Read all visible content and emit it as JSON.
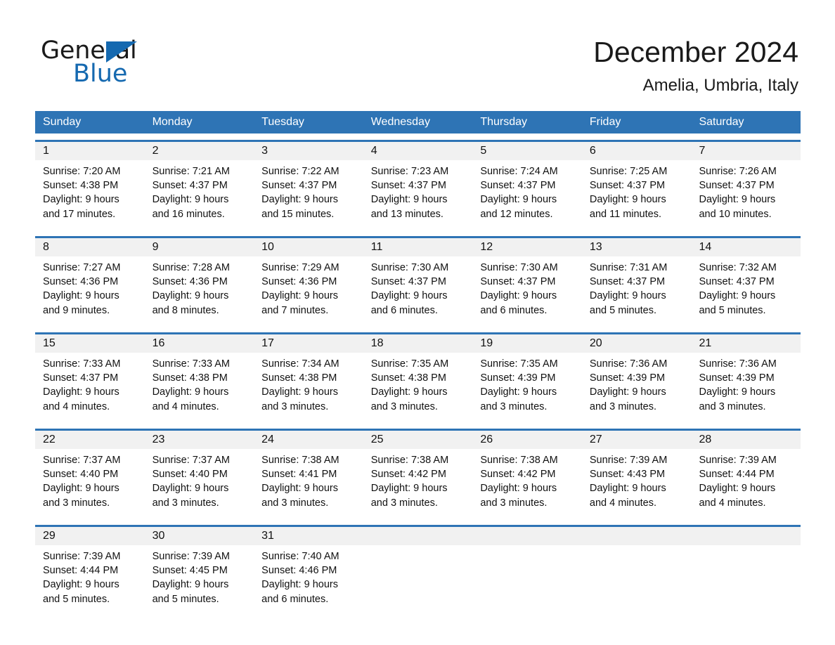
{
  "brand": {
    "name_part1": "General",
    "name_part2": "Blue",
    "triangle_color": "#1569b0"
  },
  "header": {
    "title": "December 2024",
    "subtitle": "Amelia, Umbria, Italy"
  },
  "theme": {
    "header_blue": "#2e74b5",
    "row_rule_blue": "#2e74b5",
    "daynum_band": "#f1f1f1",
    "text": "#111111"
  },
  "day_headers": [
    "Sunday",
    "Monday",
    "Tuesday",
    "Wednesday",
    "Thursday",
    "Friday",
    "Saturday"
  ],
  "weeks": [
    {
      "days": [
        {
          "num": "1",
          "l1": "Sunrise: 7:20 AM",
          "l2": "Sunset: 4:38 PM",
          "l3": "Daylight: 9 hours",
          "l4": "and 17 minutes."
        },
        {
          "num": "2",
          "l1": "Sunrise: 7:21 AM",
          "l2": "Sunset: 4:37 PM",
          "l3": "Daylight: 9 hours",
          "l4": "and 16 minutes."
        },
        {
          "num": "3",
          "l1": "Sunrise: 7:22 AM",
          "l2": "Sunset: 4:37 PM",
          "l3": "Daylight: 9 hours",
          "l4": "and 15 minutes."
        },
        {
          "num": "4",
          "l1": "Sunrise: 7:23 AM",
          "l2": "Sunset: 4:37 PM",
          "l3": "Daylight: 9 hours",
          "l4": "and 13 minutes."
        },
        {
          "num": "5",
          "l1": "Sunrise: 7:24 AM",
          "l2": "Sunset: 4:37 PM",
          "l3": "Daylight: 9 hours",
          "l4": "and 12 minutes."
        },
        {
          "num": "6",
          "l1": "Sunrise: 7:25 AM",
          "l2": "Sunset: 4:37 PM",
          "l3": "Daylight: 9 hours",
          "l4": "and 11 minutes."
        },
        {
          "num": "7",
          "l1": "Sunrise: 7:26 AM",
          "l2": "Sunset: 4:37 PM",
          "l3": "Daylight: 9 hours",
          "l4": "and 10 minutes."
        }
      ]
    },
    {
      "days": [
        {
          "num": "8",
          "l1": "Sunrise: 7:27 AM",
          "l2": "Sunset: 4:36 PM",
          "l3": "Daylight: 9 hours",
          "l4": "and 9 minutes."
        },
        {
          "num": "9",
          "l1": "Sunrise: 7:28 AM",
          "l2": "Sunset: 4:36 PM",
          "l3": "Daylight: 9 hours",
          "l4": "and 8 minutes."
        },
        {
          "num": "10",
          "l1": "Sunrise: 7:29 AM",
          "l2": "Sunset: 4:36 PM",
          "l3": "Daylight: 9 hours",
          "l4": "and 7 minutes."
        },
        {
          "num": "11",
          "l1": "Sunrise: 7:30 AM",
          "l2": "Sunset: 4:37 PM",
          "l3": "Daylight: 9 hours",
          "l4": "and 6 minutes."
        },
        {
          "num": "12",
          "l1": "Sunrise: 7:30 AM",
          "l2": "Sunset: 4:37 PM",
          "l3": "Daylight: 9 hours",
          "l4": "and 6 minutes."
        },
        {
          "num": "13",
          "l1": "Sunrise: 7:31 AM",
          "l2": "Sunset: 4:37 PM",
          "l3": "Daylight: 9 hours",
          "l4": "and 5 minutes."
        },
        {
          "num": "14",
          "l1": "Sunrise: 7:32 AM",
          "l2": "Sunset: 4:37 PM",
          "l3": "Daylight: 9 hours",
          "l4": "and 5 minutes."
        }
      ]
    },
    {
      "days": [
        {
          "num": "15",
          "l1": "Sunrise: 7:33 AM",
          "l2": "Sunset: 4:37 PM",
          "l3": "Daylight: 9 hours",
          "l4": "and 4 minutes."
        },
        {
          "num": "16",
          "l1": "Sunrise: 7:33 AM",
          "l2": "Sunset: 4:38 PM",
          "l3": "Daylight: 9 hours",
          "l4": "and 4 minutes."
        },
        {
          "num": "17",
          "l1": "Sunrise: 7:34 AM",
          "l2": "Sunset: 4:38 PM",
          "l3": "Daylight: 9 hours",
          "l4": "and 3 minutes."
        },
        {
          "num": "18",
          "l1": "Sunrise: 7:35 AM",
          "l2": "Sunset: 4:38 PM",
          "l3": "Daylight: 9 hours",
          "l4": "and 3 minutes."
        },
        {
          "num": "19",
          "l1": "Sunrise: 7:35 AM",
          "l2": "Sunset: 4:39 PM",
          "l3": "Daylight: 9 hours",
          "l4": "and 3 minutes."
        },
        {
          "num": "20",
          "l1": "Sunrise: 7:36 AM",
          "l2": "Sunset: 4:39 PM",
          "l3": "Daylight: 9 hours",
          "l4": "and 3 minutes."
        },
        {
          "num": "21",
          "l1": "Sunrise: 7:36 AM",
          "l2": "Sunset: 4:39 PM",
          "l3": "Daylight: 9 hours",
          "l4": "and 3 minutes."
        }
      ]
    },
    {
      "days": [
        {
          "num": "22",
          "l1": "Sunrise: 7:37 AM",
          "l2": "Sunset: 4:40 PM",
          "l3": "Daylight: 9 hours",
          "l4": "and 3 minutes."
        },
        {
          "num": "23",
          "l1": "Sunrise: 7:37 AM",
          "l2": "Sunset: 4:40 PM",
          "l3": "Daylight: 9 hours",
          "l4": "and 3 minutes."
        },
        {
          "num": "24",
          "l1": "Sunrise: 7:38 AM",
          "l2": "Sunset: 4:41 PM",
          "l3": "Daylight: 9 hours",
          "l4": "and 3 minutes."
        },
        {
          "num": "25",
          "l1": "Sunrise: 7:38 AM",
          "l2": "Sunset: 4:42 PM",
          "l3": "Daylight: 9 hours",
          "l4": "and 3 minutes."
        },
        {
          "num": "26",
          "l1": "Sunrise: 7:38 AM",
          "l2": "Sunset: 4:42 PM",
          "l3": "Daylight: 9 hours",
          "l4": "and 3 minutes."
        },
        {
          "num": "27",
          "l1": "Sunrise: 7:39 AM",
          "l2": "Sunset: 4:43 PM",
          "l3": "Daylight: 9 hours",
          "l4": "and 4 minutes."
        },
        {
          "num": "28",
          "l1": "Sunrise: 7:39 AM",
          "l2": "Sunset: 4:44 PM",
          "l3": "Daylight: 9 hours",
          "l4": "and 4 minutes."
        }
      ]
    },
    {
      "days": [
        {
          "num": "29",
          "l1": "Sunrise: 7:39 AM",
          "l2": "Sunset: 4:44 PM",
          "l3": "Daylight: 9 hours",
          "l4": "and 5 minutes."
        },
        {
          "num": "30",
          "l1": "Sunrise: 7:39 AM",
          "l2": "Sunset: 4:45 PM",
          "l3": "Daylight: 9 hours",
          "l4": "and 5 minutes."
        },
        {
          "num": "31",
          "l1": "Sunrise: 7:40 AM",
          "l2": "Sunset: 4:46 PM",
          "l3": "Daylight: 9 hours",
          "l4": "and 6 minutes."
        },
        {
          "num": "",
          "l1": "",
          "l2": "",
          "l3": "",
          "l4": ""
        },
        {
          "num": "",
          "l1": "",
          "l2": "",
          "l3": "",
          "l4": ""
        },
        {
          "num": "",
          "l1": "",
          "l2": "",
          "l3": "",
          "l4": ""
        },
        {
          "num": "",
          "l1": "",
          "l2": "",
          "l3": "",
          "l4": ""
        }
      ]
    }
  ]
}
